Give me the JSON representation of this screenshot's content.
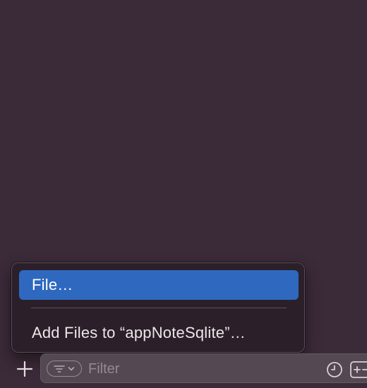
{
  "popup_menu": {
    "items": [
      {
        "label": "File…",
        "selected": true
      },
      {
        "label": "Add Files to “appNoteSqlite”…",
        "selected": false
      }
    ]
  },
  "bottom_bar": {
    "add_icon": "plus-icon",
    "filter": {
      "placeholder": "Filter",
      "filter_options_icon": "filter-lines-icon",
      "chevron_icon": "chevron-down-icon",
      "recent_icon": "clock-icon",
      "scm_icon": "plus-minus-square-icon"
    }
  },
  "colors": {
    "background": "#3b2a38",
    "menu_background": "#2b2029",
    "selection": "#2f68bf",
    "filter_field": "#544853"
  }
}
